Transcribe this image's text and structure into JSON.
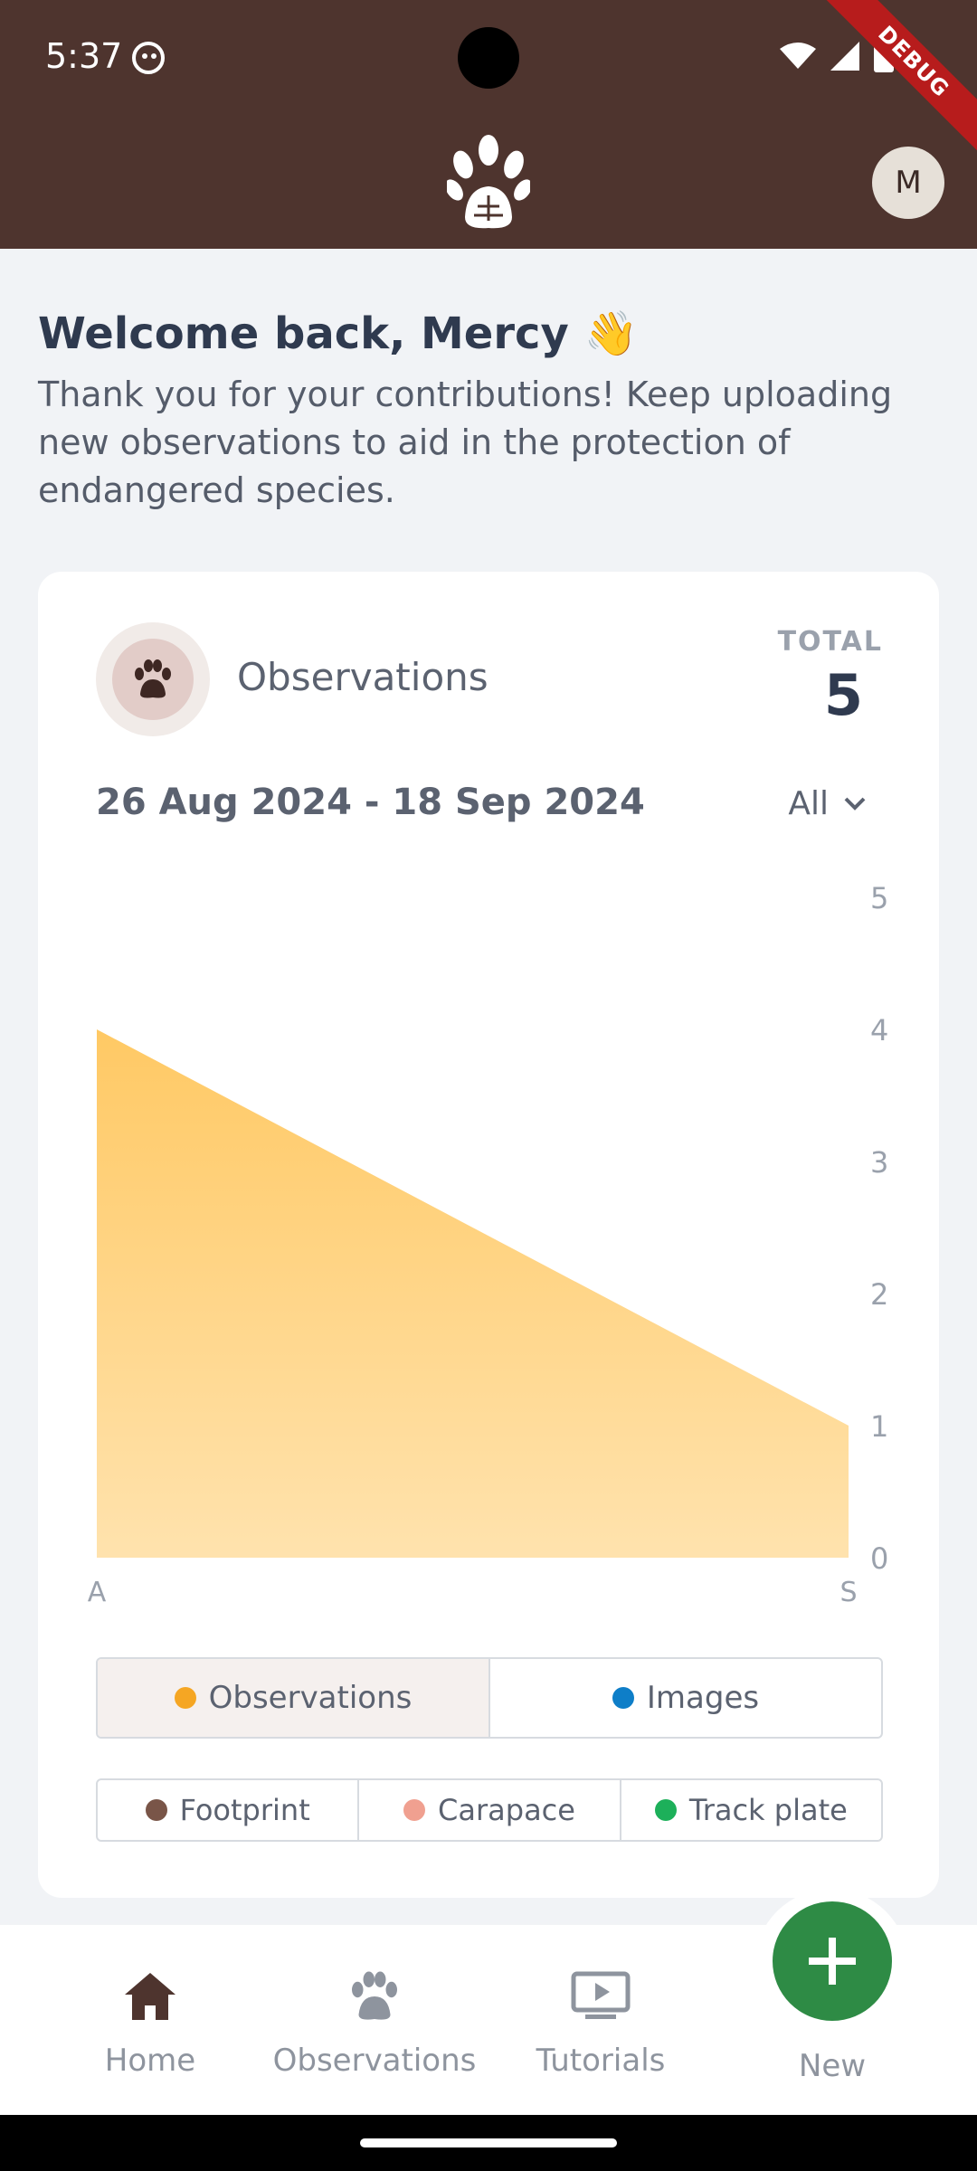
{
  "status_bar": {
    "time": "5:37",
    "debug_label": "DEBUG"
  },
  "header": {
    "logo_icon": "paw-print-logo",
    "avatar_initial": "M"
  },
  "welcome": {
    "title": "Welcome back, Mercy 👋",
    "message": "Thank you for your contributions! Keep uploading new observations to aid in the protection of endangered species."
  },
  "observations_card": {
    "title": "Observations",
    "total_label": "TOTAL",
    "total_value": "5",
    "date_range": "26 Aug 2024 - 18 Sep 2024",
    "filter_value": "All"
  },
  "chart_data": {
    "type": "area",
    "x": [
      "A",
      "S"
    ],
    "values": [
      4,
      1
    ],
    "y_ticks": [
      "5",
      "4",
      "3",
      "2",
      "1",
      "0"
    ],
    "ylim": [
      0,
      5
    ],
    "fill_color": "#FFC65C"
  },
  "toggle_primary": [
    {
      "label": "Observations",
      "color": "#F5A623",
      "active": true
    },
    {
      "label": "Images",
      "color": "#0E7EC8",
      "active": false
    }
  ],
  "toggle_types": [
    {
      "label": "Footprint",
      "color": "#795548"
    },
    {
      "label": "Carapace",
      "color": "#F0A090"
    },
    {
      "label": "Track plate",
      "color": "#1DB05A"
    }
  ],
  "bottom_nav": {
    "home": "Home",
    "observations": "Observations",
    "tutorials": "Tutorials",
    "new": "New"
  },
  "colors": {
    "brand": "#4E342E",
    "accent_green": "#2E8B45"
  }
}
